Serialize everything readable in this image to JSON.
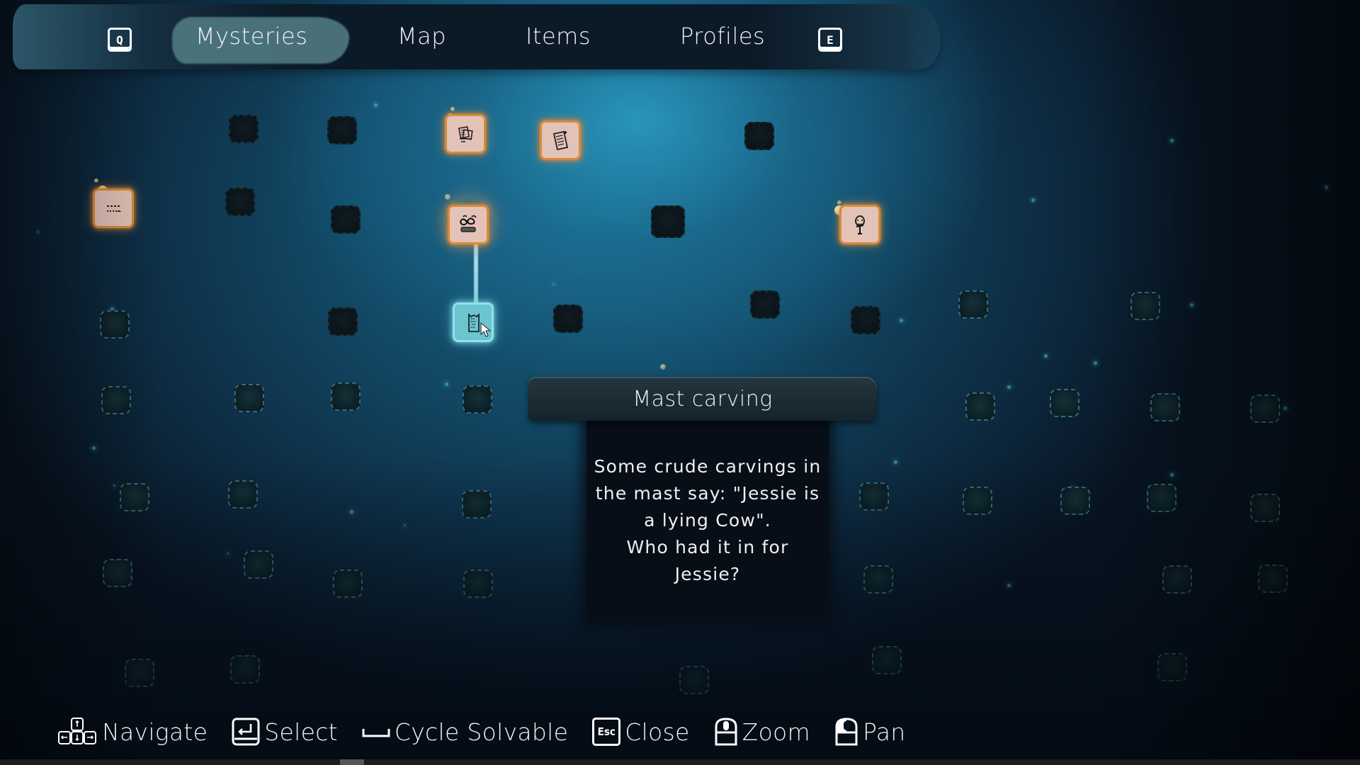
{
  "nav": {
    "prev_key": "Q",
    "next_key": "E",
    "tabs": [
      {
        "label": "Mysteries",
        "active": true
      },
      {
        "label": "Map",
        "active": false
      },
      {
        "label": "Items",
        "active": false
      },
      {
        "label": "Profiles",
        "active": false
      }
    ]
  },
  "board": {
    "discovered_clues": [
      {
        "id": "clue-left-note",
        "icon": "note-icon",
        "state": "discovered"
      },
      {
        "id": "clue-papers",
        "icon": "papers-icon",
        "state": "discovered"
      },
      {
        "id": "clue-scroll",
        "icon": "scroll-icon",
        "state": "discovered"
      },
      {
        "id": "clue-glasses",
        "icon": "glasses-icon",
        "state": "highlighted"
      },
      {
        "id": "clue-portrait",
        "icon": "portrait-icon",
        "state": "discovered"
      },
      {
        "id": "clue-mast-carving",
        "icon": "carving-icon",
        "state": "selected"
      }
    ],
    "accent_colors": {
      "clue_glow": "#d98a3a",
      "selected_glow": "#8fe2ea",
      "background": "#124865"
    }
  },
  "tooltip": {
    "title": "Mast carving",
    "description": "Some crude carvings in\nthe mast say: \"Jessie is\na lying Cow\".\nWho had it in for\nJessie?"
  },
  "controls": [
    {
      "key": "arrow-keys",
      "label": "Navigate"
    },
    {
      "key": "enter",
      "label": "Select"
    },
    {
      "key": "space",
      "label": "Cycle Solvable"
    },
    {
      "key": "Esc",
      "label": "Close"
    },
    {
      "key": "mouse-wheel",
      "label": "Zoom"
    },
    {
      "key": "mouse-drag",
      "label": "Pan"
    }
  ]
}
